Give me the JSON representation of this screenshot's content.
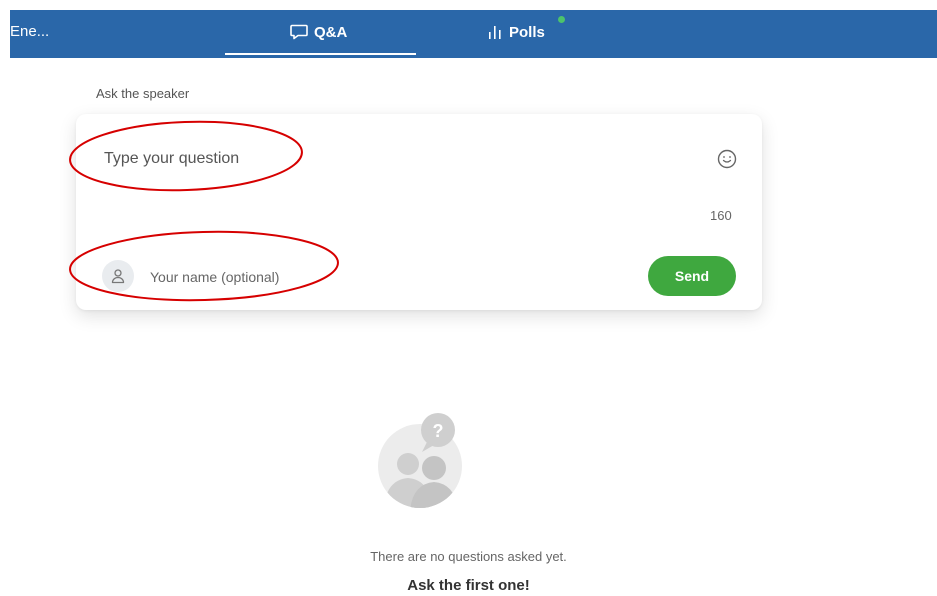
{
  "header": {
    "event_title": "Ene...",
    "tabs": [
      {
        "label": "Q&A",
        "icon": "speech-bubble-icon",
        "active": true
      },
      {
        "label": "Polls",
        "icon": "bar-chart-icon",
        "active": false,
        "indicator": "new-dot"
      }
    ],
    "bg_color": "#2a67a9"
  },
  "ask": {
    "label": "Ask the speaker",
    "question_placeholder": "Type your question",
    "char_count": "160",
    "name_placeholder": "Your name (optional)",
    "send_label": "Send",
    "send_color": "#3fa83f"
  },
  "annotations": {
    "color": "#d60000",
    "shapes": [
      "ellipse around question field",
      "ellipse around name field"
    ]
  },
  "empty_state": {
    "icon": "people-question-icon",
    "line1": "There are no questions asked yet.",
    "line2": "Ask the first one!"
  }
}
